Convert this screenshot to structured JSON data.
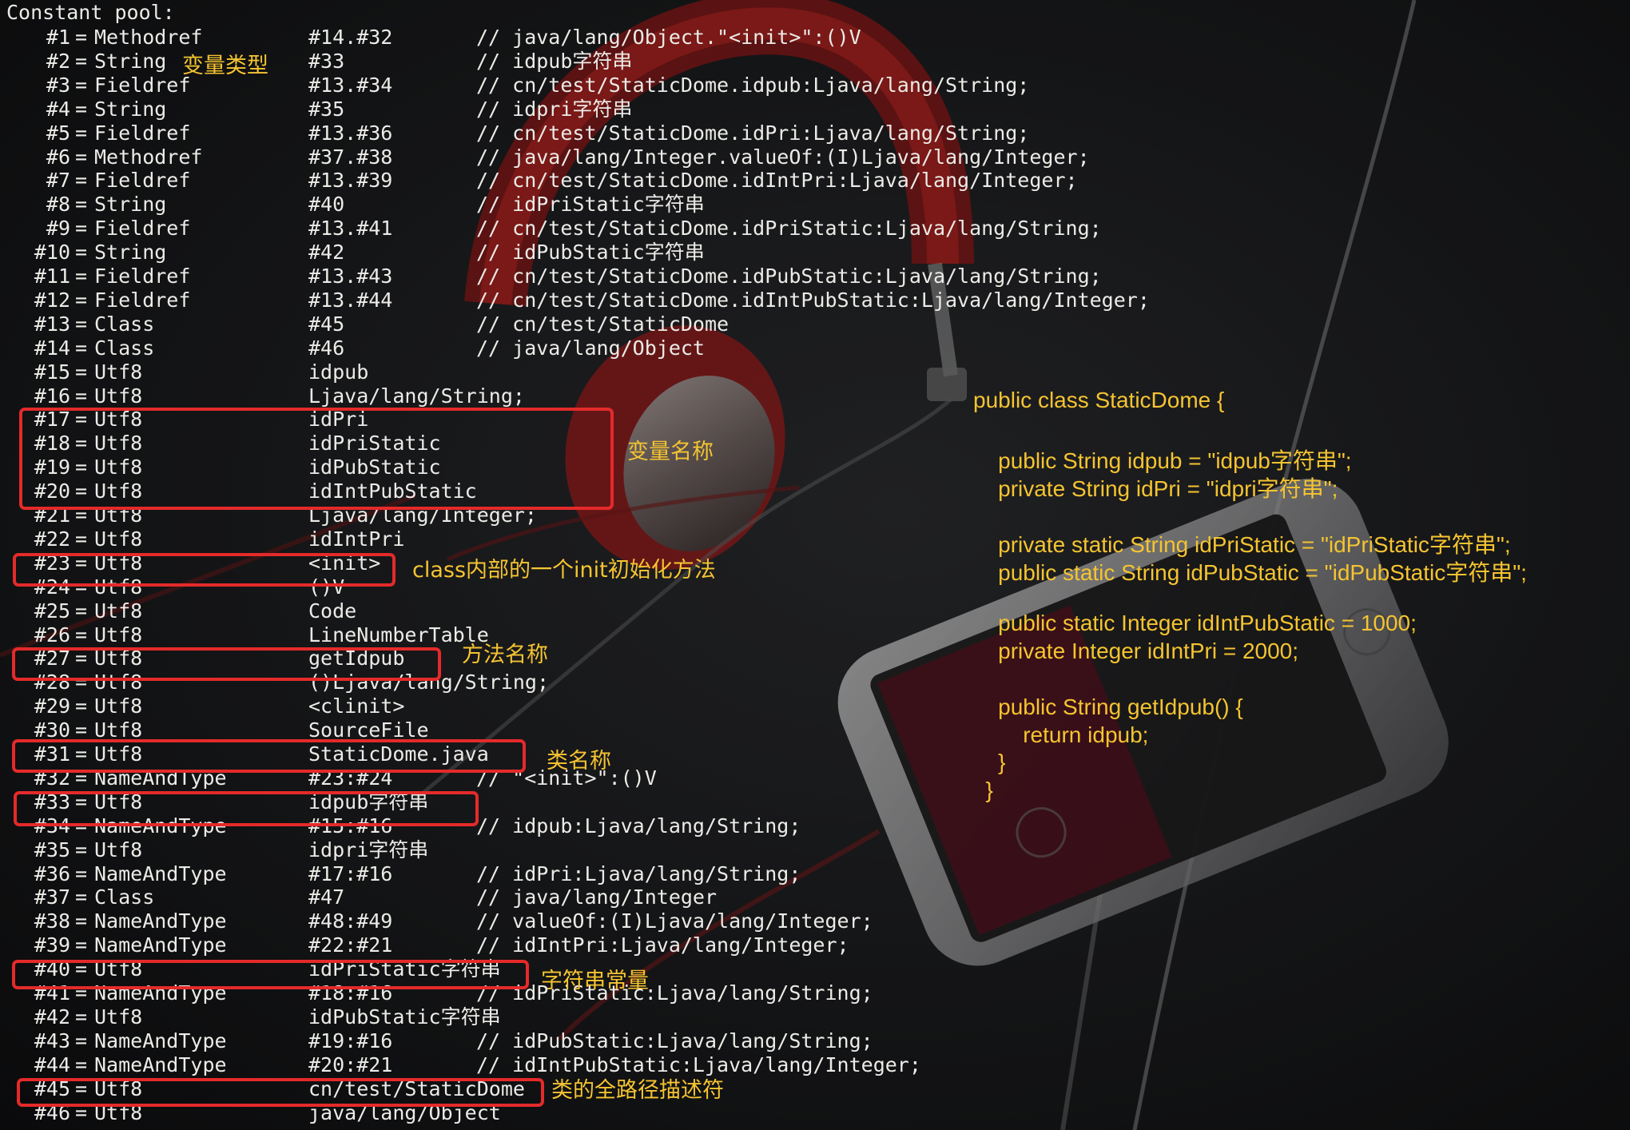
{
  "terminal": {
    "header": "Constant pool:",
    "entries": [
      {
        "idx": "#1",
        "type": "Methodref",
        "value": "#14.#32",
        "comment": "// java/lang/Object.\"<init>\":()V"
      },
      {
        "idx": "#2",
        "type": "String",
        "value": "#33",
        "comment": "// idpub字符串"
      },
      {
        "idx": "#3",
        "type": "Fieldref",
        "value": "#13.#34",
        "comment": "// cn/test/StaticDome.idpub:Ljava/lang/String;"
      },
      {
        "idx": "#4",
        "type": "String",
        "value": "#35",
        "comment": "// idpri字符串"
      },
      {
        "idx": "#5",
        "type": "Fieldref",
        "value": "#13.#36",
        "comment": "// cn/test/StaticDome.idPri:Ljava/lang/String;"
      },
      {
        "idx": "#6",
        "type": "Methodref",
        "value": "#37.#38",
        "comment": "// java/lang/Integer.valueOf:(I)Ljava/lang/Integer;"
      },
      {
        "idx": "#7",
        "type": "Fieldref",
        "value": "#13.#39",
        "comment": "// cn/test/StaticDome.idIntPri:Ljava/lang/Integer;"
      },
      {
        "idx": "#8",
        "type": "String",
        "value": "#40",
        "comment": "// idPriStatic字符串"
      },
      {
        "idx": "#9",
        "type": "Fieldref",
        "value": "#13.#41",
        "comment": "// cn/test/StaticDome.idPriStatic:Ljava/lang/String;"
      },
      {
        "idx": "#10",
        "type": "String",
        "value": "#42",
        "comment": "// idPubStatic字符串"
      },
      {
        "idx": "#11",
        "type": "Fieldref",
        "value": "#13.#43",
        "comment": "// cn/test/StaticDome.idPubStatic:Ljava/lang/String;"
      },
      {
        "idx": "#12",
        "type": "Fieldref",
        "value": "#13.#44",
        "comment": "// cn/test/StaticDome.idIntPubStatic:Ljava/lang/Integer;"
      },
      {
        "idx": "#13",
        "type": "Class",
        "value": "#45",
        "comment": "// cn/test/StaticDome"
      },
      {
        "idx": "#14",
        "type": "Class",
        "value": "#46",
        "comment": "// java/lang/Object"
      },
      {
        "idx": "#15",
        "type": "Utf8",
        "value": "idpub",
        "comment": ""
      },
      {
        "idx": "#16",
        "type": "Utf8",
        "value": "Ljava/lang/String;",
        "comment": ""
      },
      {
        "idx": "#17",
        "type": "Utf8",
        "value": "idPri",
        "comment": ""
      },
      {
        "idx": "#18",
        "type": "Utf8",
        "value": "idPriStatic",
        "comment": ""
      },
      {
        "idx": "#19",
        "type": "Utf8",
        "value": "idPubStatic",
        "comment": ""
      },
      {
        "idx": "#20",
        "type": "Utf8",
        "value": "idIntPubStatic",
        "comment": ""
      },
      {
        "idx": "#21",
        "type": "Utf8",
        "value": "Ljava/lang/Integer;",
        "comment": ""
      },
      {
        "idx": "#22",
        "type": "Utf8",
        "value": "idIntPri",
        "comment": ""
      },
      {
        "idx": "#23",
        "type": "Utf8",
        "value": "<init>",
        "comment": ""
      },
      {
        "idx": "#24",
        "type": "Utf8",
        "value": "()V",
        "comment": ""
      },
      {
        "idx": "#25",
        "type": "Utf8",
        "value": "Code",
        "comment": ""
      },
      {
        "idx": "#26",
        "type": "Utf8",
        "value": "LineNumberTable",
        "comment": ""
      },
      {
        "idx": "#27",
        "type": "Utf8",
        "value": "getIdpub",
        "comment": ""
      },
      {
        "idx": "#28",
        "type": "Utf8",
        "value": "()Ljava/lang/String;",
        "comment": ""
      },
      {
        "idx": "#29",
        "type": "Utf8",
        "value": "<clinit>",
        "comment": ""
      },
      {
        "idx": "#30",
        "type": "Utf8",
        "value": "SourceFile",
        "comment": ""
      },
      {
        "idx": "#31",
        "type": "Utf8",
        "value": "StaticDome.java",
        "comment": ""
      },
      {
        "idx": "#32",
        "type": "NameAndType",
        "value": "#23:#24",
        "comment": "// \"<init>\":()V"
      },
      {
        "idx": "#33",
        "type": "Utf8",
        "value": "idpub字符串",
        "comment": ""
      },
      {
        "idx": "#34",
        "type": "NameAndType",
        "value": "#15:#16",
        "comment": "// idpub:Ljava/lang/String;"
      },
      {
        "idx": "#35",
        "type": "Utf8",
        "value": "idpri字符串",
        "comment": ""
      },
      {
        "idx": "#36",
        "type": "NameAndType",
        "value": "#17:#16",
        "comment": "// idPri:Ljava/lang/String;"
      },
      {
        "idx": "#37",
        "type": "Class",
        "value": "#47",
        "comment": "// java/lang/Integer"
      },
      {
        "idx": "#38",
        "type": "NameAndType",
        "value": "#48:#49",
        "comment": "// valueOf:(I)Ljava/lang/Integer;"
      },
      {
        "idx": "#39",
        "type": "NameAndType",
        "value": "#22:#21",
        "comment": "// idIntPri:Ljava/lang/Integer;"
      },
      {
        "idx": "#40",
        "type": "Utf8",
        "value": "idPriStatic字符串",
        "comment": ""
      },
      {
        "idx": "#41",
        "type": "NameAndType",
        "value": "#18:#16",
        "comment": "// idPriStatic:Ljava/lang/String;"
      },
      {
        "idx": "#42",
        "type": "Utf8",
        "value": "idPubStatic字符串",
        "comment": ""
      },
      {
        "idx": "#43",
        "type": "NameAndType",
        "value": "#19:#16",
        "comment": "// idPubStatic:Ljava/lang/String;"
      },
      {
        "idx": "#44",
        "type": "NameAndType",
        "value": "#20:#21",
        "comment": "// idIntPubStatic:Ljava/lang/Integer;"
      },
      {
        "idx": "#45",
        "type": "Utf8",
        "value": "cn/test/StaticDome",
        "comment": ""
      },
      {
        "idx": "#46",
        "type": "Utf8",
        "value": "java/lang/Object",
        "comment": ""
      }
    ]
  },
  "annotations": {
    "variable_type": "变量类型",
    "variable_name": "变量名称",
    "init_method": "class内部的一个init初始化方法",
    "method_name": "方法名称",
    "class_name": "类名称",
    "string_constant": "字符串常量",
    "class_full_path": "类的全路径描述符"
  },
  "source_code": {
    "lines": [
      "public class StaticDome {",
      "    public String idpub = \"idpub字符串\";",
      "    private String idPri = \"idpri字符串\";",
      "    private static String idPriStatic = \"idPriStatic字符串\";",
      "    public static String idPubStatic = \"idPubStatic字符串\";",
      "    public static Integer idIntPubStatic = 1000;",
      "    private Integer idIntPri = 2000;",
      "    public String getIdpub() {",
      "        return idpub;",
      "    }",
      "  }"
    ]
  },
  "colors": {
    "terminal_text": "#ecebe7",
    "annotation": "#f5c431",
    "highlight_box": "#e42a2a",
    "background": "#141517"
  }
}
